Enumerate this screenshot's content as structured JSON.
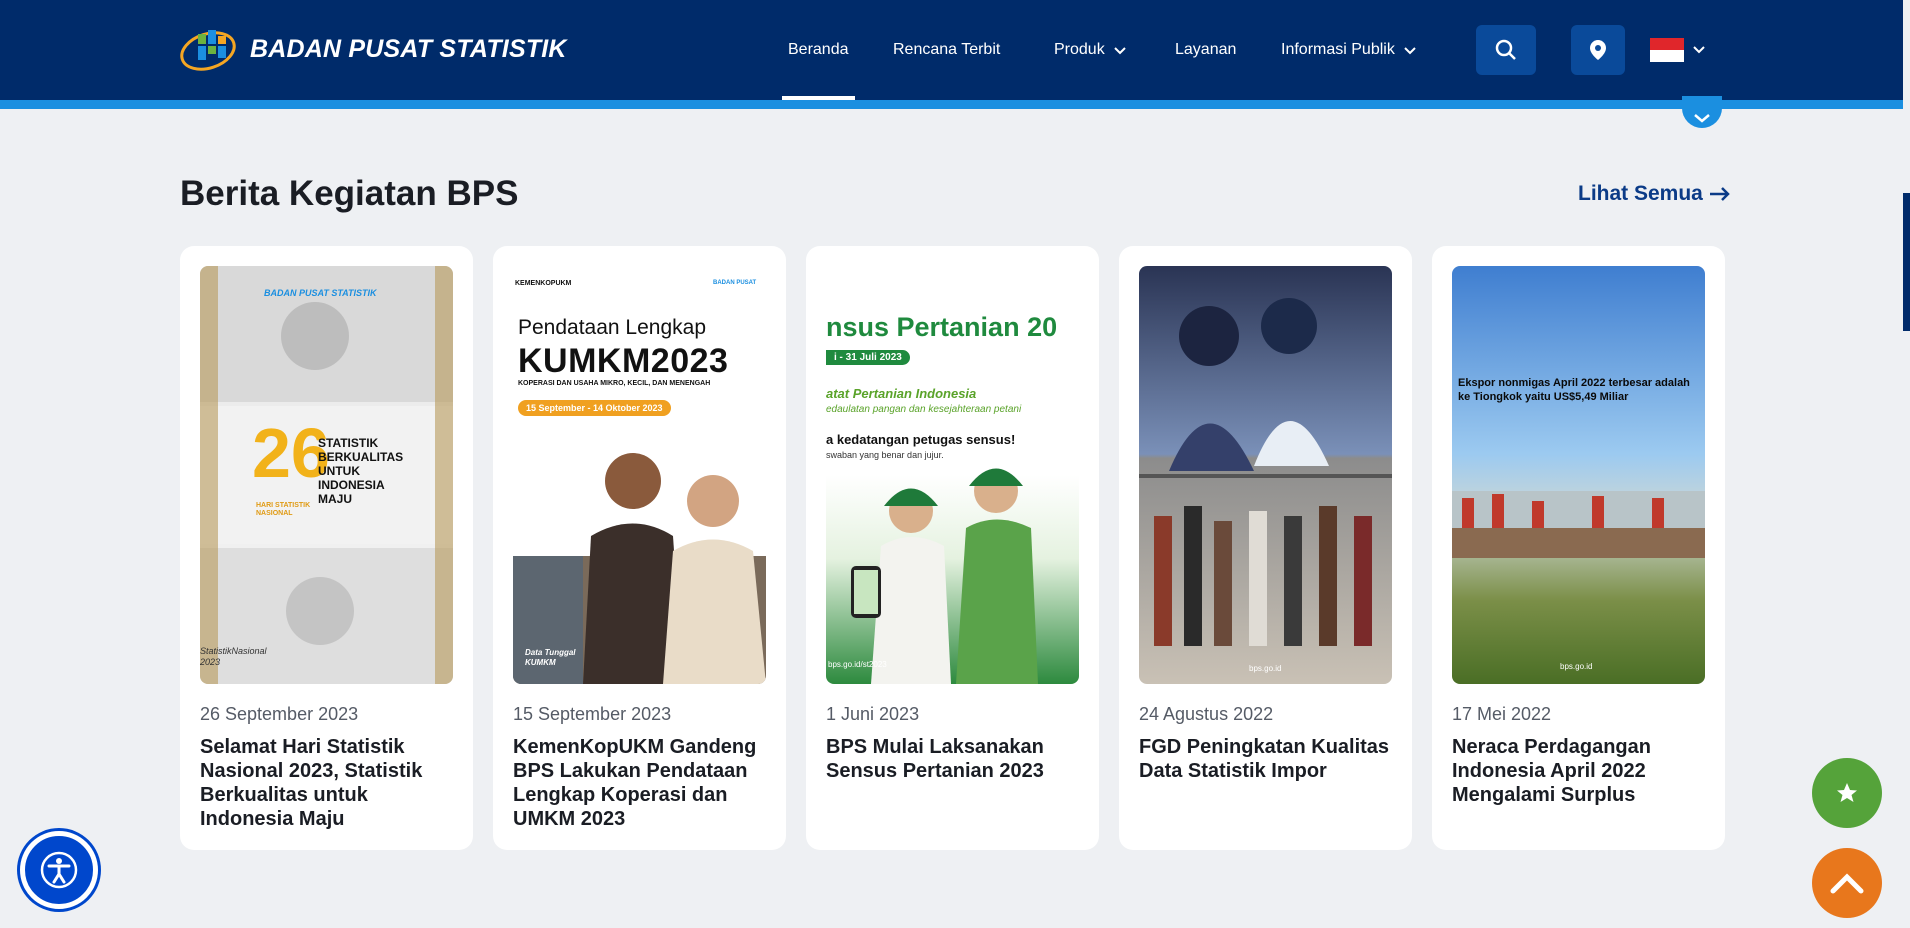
{
  "header": {
    "logo_text": "BADAN PUSAT STATISTIK",
    "nav": [
      {
        "label": "Beranda"
      },
      {
        "label": "Rencana Terbit"
      },
      {
        "label": "Produk"
      },
      {
        "label": "Layanan"
      },
      {
        "label": "Informasi Publik"
      }
    ],
    "active_nav": "Beranda",
    "icons": [
      "search-icon",
      "location-pin-icon",
      "flag-indonesia-icon",
      "chevron-down-icon"
    ]
  },
  "section": {
    "title": "Berita Kegiatan BPS",
    "see_all": "Lihat Semua",
    "see_all_icon": "arrow-right-icon"
  },
  "cards": [
    {
      "date": "26 September 2023",
      "title": "Selamat Hari Statistik Nasional 2023, Statistik Berkualitas untuk Indonesia Maju",
      "img_text": {
        "brand": "BADAN PUSAT STATISTIK",
        "number": "26",
        "headline": "STATISTIK BERKUALITAS UNTUK INDONESIA MAJU",
        "sub": "HARI STATISTIK NASIONAL",
        "footer": "StatistikNasional 2023"
      }
    },
    {
      "date": "15 September 2023",
      "title": "KemenKopUKM Gandeng BPS Lakukan Pendataan Lengkap Koperasi dan UMKM 2023",
      "img_text": {
        "brand_left": "KEMENKOPUKM",
        "brand_right": "BADAN PUSAT",
        "line1": "Pendataan Lengkap",
        "line2": "KUMKM2023",
        "line3": "KOPERASI DAN USAHA MIKRO, KECIL, DAN MENENGAH",
        "badge": "15 September - 14 Oktober 2023",
        "footer": "Data Tunggal KUMKM"
      }
    },
    {
      "date": "1 Juni 2023",
      "title": "BPS Mulai Laksanakan Sensus Pertanian 2023",
      "img_text": {
        "line1": "nsus Pertanian 20",
        "badge": "i - 31 Juli 2023",
        "line2": "atat Pertanian Indonesia",
        "line3": "edaulatan pangan dan kesejahteraan petani",
        "line4": "a kedatangan petugas sensus!",
        "line5": "swaban yang benar dan jujur.",
        "footer": "bps.go.id/st2023"
      }
    },
    {
      "date": "24 Agustus 2022",
      "title": "FGD Peningkatan Kualitas Data Statistik Impor",
      "img_text": {
        "footer": "bps.go.id"
      }
    },
    {
      "date": "17 Mei 2022",
      "title": "Neraca Perdagangan Indonesia April 2022 Mengalami Surplus",
      "img_text": {
        "caption": "Ekspor nonmigas April 2022 terbesar adalah ke Tiongkok yaitu US$5,49 Miliar",
        "footer": "bps.go.id"
      }
    }
  ],
  "colors": {
    "header_bg": "#002b6a",
    "accent_strip": "#1b8fe0",
    "link": "#0b3b87",
    "fab_star": "#55a33a",
    "fab_up": "#e8771c",
    "fab_access": "#0047cc"
  },
  "floating": {
    "accessibility_icon": "accessibility-icon",
    "favorite_icon": "star-icon",
    "scroll_top_icon": "chevron-up-icon"
  }
}
